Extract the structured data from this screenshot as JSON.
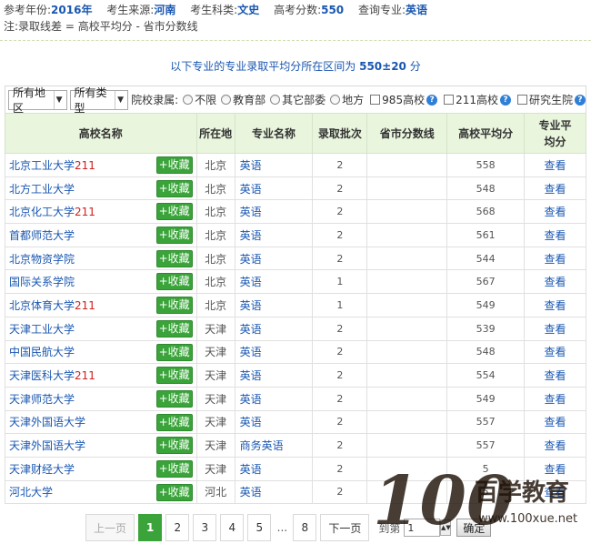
{
  "info": {
    "year_label": "参考年份:",
    "year": "2016年",
    "source_label": "考生来源:",
    "source": "河南",
    "subject_label": "考生科类:",
    "subject": "文史",
    "score_label": "高考分数:",
    "score": "550",
    "query_label": "查询专业:",
    "query": "英语",
    "note": "注:录取线差 = 高校平均分 - 省市分数线"
  },
  "range_text": "以下专业的专业录取平均分所在区间为",
  "range_value": "550±20",
  "range_unit": "分",
  "filters": {
    "region": "所有地区",
    "type": "所有类型",
    "affiliation_label": "院校隶属:",
    "options": [
      "不限",
      "教育部",
      "其它部委",
      "地方"
    ],
    "checks": [
      "985高校",
      "211高校",
      "研究生院"
    ]
  },
  "table": {
    "headers": [
      "高校名称",
      "所在地",
      "专业名称",
      "录取批次",
      "省市分数线",
      "高校平均分",
      "专业平均分"
    ],
    "fav_label": "+收藏",
    "view_label": "查看",
    "rows": [
      {
        "school": "北京工业大学",
        "tag": "211",
        "loc": "北京",
        "major": "英语",
        "batch": "2",
        "line": "",
        "avg": "558"
      },
      {
        "school": "北方工业大学",
        "tag": "",
        "loc": "北京",
        "major": "英语",
        "batch": "2",
        "line": "",
        "avg": "548"
      },
      {
        "school": "北京化工大学",
        "tag": "211",
        "loc": "北京",
        "major": "英语",
        "batch": "2",
        "line": "",
        "avg": "568"
      },
      {
        "school": "首都师范大学",
        "tag": "",
        "loc": "北京",
        "major": "英语",
        "batch": "2",
        "line": "",
        "avg": "561"
      },
      {
        "school": "北京物资学院",
        "tag": "",
        "loc": "北京",
        "major": "英语",
        "batch": "2",
        "line": "",
        "avg": "544"
      },
      {
        "school": "国际关系学院",
        "tag": "",
        "loc": "北京",
        "major": "英语",
        "batch": "1",
        "line": "",
        "avg": "567"
      },
      {
        "school": "北京体育大学",
        "tag": "211",
        "loc": "北京",
        "major": "英语",
        "batch": "1",
        "line": "",
        "avg": "549"
      },
      {
        "school": "天津工业大学",
        "tag": "",
        "loc": "天津",
        "major": "英语",
        "batch": "2",
        "line": "",
        "avg": "539"
      },
      {
        "school": "中国民航大学",
        "tag": "",
        "loc": "天津",
        "major": "英语",
        "batch": "2",
        "line": "",
        "avg": "548"
      },
      {
        "school": "天津医科大学",
        "tag": "211",
        "loc": "天津",
        "major": "英语",
        "batch": "2",
        "line": "",
        "avg": "554"
      },
      {
        "school": "天津师范大学",
        "tag": "",
        "loc": "天津",
        "major": "英语",
        "batch": "2",
        "line": "",
        "avg": "549"
      },
      {
        "school": "天津外国语大学",
        "tag": "",
        "loc": "天津",
        "major": "英语",
        "batch": "2",
        "line": "",
        "avg": "557"
      },
      {
        "school": "天津外国语大学",
        "tag": "",
        "loc": "天津",
        "major": "商务英语",
        "batch": "2",
        "line": "",
        "avg": "557"
      },
      {
        "school": "天津财经大学",
        "tag": "",
        "loc": "天津",
        "major": "英语",
        "batch": "2",
        "line": "",
        "avg": "5"
      },
      {
        "school": "河北大学",
        "tag": "",
        "loc": "河北",
        "major": "英语",
        "batch": "2",
        "line": "",
        "avg": "5"
      }
    ]
  },
  "pager": {
    "prev": "上一页",
    "pages": [
      "1",
      "2",
      "3",
      "4",
      "5"
    ],
    "ellipsis": "...",
    "last": "8",
    "next": "下一页",
    "goto_label": "到第",
    "goto_value": "1",
    "ok": "确定"
  },
  "watermark": {
    "brand": "100",
    "text": "百学教育",
    "url": "www.100xue.net"
  },
  "colors": {
    "accent_blue": "#1a57b0",
    "green": "#3aa43a",
    "tag_red": "#d0201d",
    "header_bg": "#e9f5dd"
  }
}
